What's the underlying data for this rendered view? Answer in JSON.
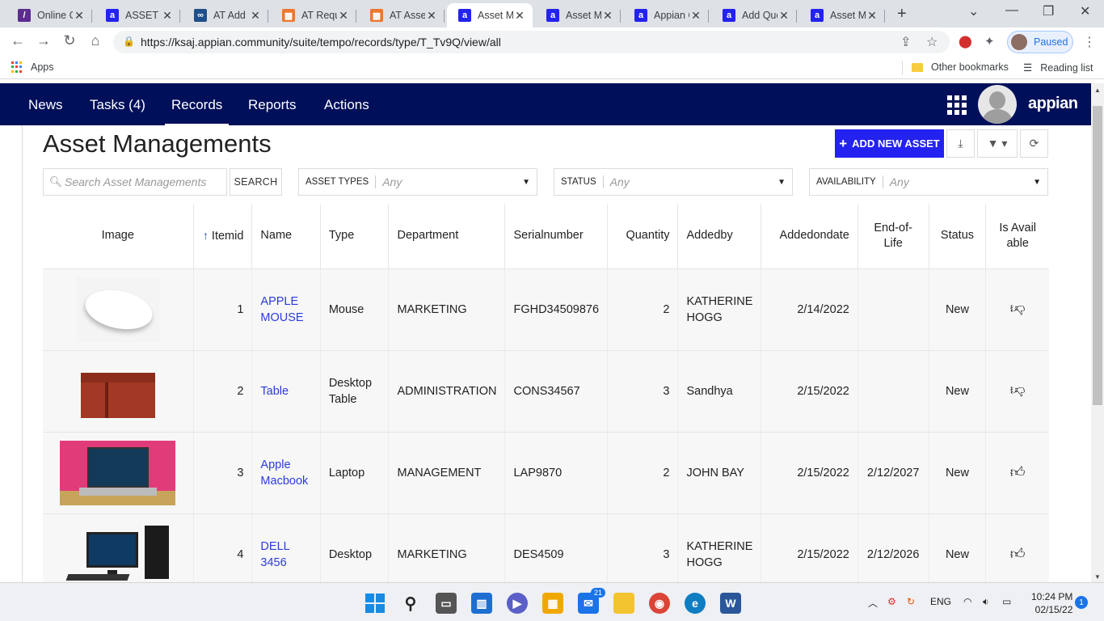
{
  "browser": {
    "tabs": [
      {
        "title": "Online C",
        "fav": "/",
        "color": "#5b2d90",
        "active": false
      },
      {
        "title": "ASSET M",
        "fav": "a",
        "color": "#2322f0",
        "active": false
      },
      {
        "title": "AT Add I",
        "fav": "∞",
        "color": "#1e4f8a",
        "active": false
      },
      {
        "title": "AT Requ",
        "fav": "▦",
        "color": "#f0772b",
        "active": false
      },
      {
        "title": "AT Asset",
        "fav": "▦",
        "color": "#f0772b",
        "active": false
      },
      {
        "title": "Asset M",
        "fav": "a",
        "color": "#2322f0",
        "active": true
      },
      {
        "title": "Asset M",
        "fav": "a",
        "color": "#2322f0",
        "active": false
      },
      {
        "title": "Appian C",
        "fav": "a",
        "color": "#2322f0",
        "active": false
      },
      {
        "title": "Add Que",
        "fav": "a",
        "color": "#2322f0",
        "active": false
      },
      {
        "title": "Asset M",
        "fav": "a",
        "color": "#2322f0",
        "active": false
      }
    ],
    "url": "https://ksaj.appian.community/suite/tempo/records/type/T_Tv9Q/view/all",
    "profile_label": "Paused",
    "bookmarks": {
      "apps": "Apps",
      "other": "Other bookmarks",
      "reading": "Reading list"
    }
  },
  "nav": {
    "items": [
      "News",
      "Tasks (4)",
      "Records",
      "Reports",
      "Actions"
    ],
    "active": "Records",
    "brand": "appian"
  },
  "page": {
    "title": "Asset Managements",
    "add_button": "ADD NEW ASSET",
    "search_placeholder": "Search Asset Managements",
    "search_button": "SEARCH",
    "filters": [
      {
        "label": "ASSET TYPES",
        "value": "Any"
      },
      {
        "label": "STATUS",
        "value": "Any"
      },
      {
        "label": "AVAILABILITY",
        "value": "Any"
      }
    ]
  },
  "table": {
    "headers": [
      "Image",
      "Itemid",
      "Name",
      "Type",
      "Department",
      "Serialnumber",
      "Quantity",
      "Addedby",
      "Addedondate",
      "End-of-Life",
      "Status",
      "Is Available"
    ],
    "rows": [
      {
        "image": "mouse",
        "itemid": "1",
        "name": "APPLE MOUSE",
        "type": "Mouse",
        "department": "MARKETING",
        "serial": "FGHD34509876",
        "quantity": "2",
        "addedby": "KATHERINE HOGG",
        "date": "2/14/2022",
        "eol": "",
        "status": "New",
        "available": "thumbs-down-icon"
      },
      {
        "image": "table",
        "itemid": "2",
        "name": "Table",
        "type": "Desktop Table",
        "department": "ADMINISTRATION",
        "serial": "CONS34567",
        "quantity": "3",
        "addedby": "Sandhya",
        "date": "2/15/2022",
        "eol": "",
        "status": "New",
        "available": "thumbs-down-icon"
      },
      {
        "image": "laptop",
        "itemid": "3",
        "name": "Apple Macbook",
        "type": "Laptop",
        "department": "MANAGEMENT",
        "serial": "LAP9870",
        "quantity": "2",
        "addedby": "JOHN BAY",
        "date": "2/15/2022",
        "eol": "2/12/2027",
        "status": "New",
        "available": "thumbs-up-icon"
      },
      {
        "image": "desktop",
        "itemid": "4",
        "name": "DELL 3456",
        "type": "Desktop",
        "department": "MARKETING",
        "serial": "DES4509",
        "quantity": "3",
        "addedby": "KATHERINE HOGG",
        "date": "2/15/2022",
        "eol": "2/12/2026",
        "status": "New",
        "available": "thumbs-up-icon"
      }
    ]
  },
  "taskbar": {
    "mail_badge": "21",
    "lang": "ENG",
    "time": "10:24 PM",
    "date": "02/15/22",
    "notifications": "1"
  }
}
